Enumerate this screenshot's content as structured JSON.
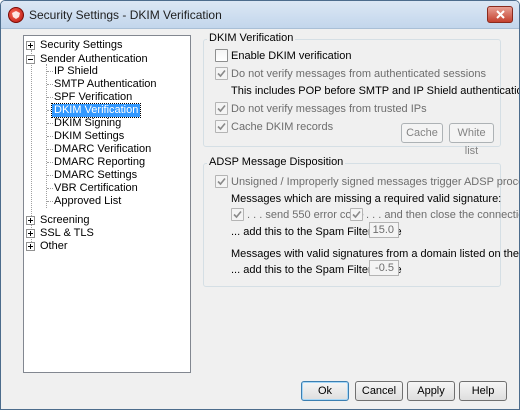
{
  "window": {
    "title": "Security Settings - DKIM Verification"
  },
  "tree": {
    "security_settings": "Security Settings",
    "sender_authentication": "Sender Authentication",
    "children": [
      "IP Shield",
      "SMTP Authentication",
      "SPF Verification",
      "DKIM Verification",
      "DKIM Signing",
      "DKIM Settings",
      "DMARC Verification",
      "DMARC Reporting",
      "DMARC Settings",
      "VBR Certification",
      "Approved List"
    ],
    "screening": "Screening",
    "ssl_tls": "SSL & TLS",
    "other": "Other"
  },
  "dkim": {
    "group_label": "DKIM Verification",
    "enable_label": "Enable DKIM verification",
    "enable_checked": false,
    "no_verify_auth_label": "Do not verify messages from authenticated sessions",
    "no_verify_auth_checked": true,
    "pop_note": "This includes POP before SMTP and IP Shield authentication.",
    "no_verify_trusted_label": "Do not verify messages from trusted IPs",
    "no_verify_trusted_checked": true,
    "cache_label": "Cache DKIM records",
    "cache_checked": true,
    "cache_button": "Cache",
    "whitelist_button": "White list"
  },
  "adsp": {
    "group_label": "ADSP Message Disposition",
    "unsigned_label": "Unsigned / Improperly signed messages trigger ADSP processing",
    "unsigned_checked": true,
    "missing_sig_heading": "Messages which are missing a required valid signature:",
    "send550_label": ". . . send 550 error code",
    "send550_checked": true,
    "close_conn_label": ". . . and then close the connection",
    "close_conn_checked": true,
    "spam_score_label_1": "... add this to the Spam Filter score",
    "spam_score_value_1": "15.0",
    "approved_heading": "Messages with valid signatures from a domain listed on the 'Approved List':",
    "spam_score_label_2": "... add this to the Spam Filter score",
    "spam_score_value_2": "-0.5"
  },
  "buttons": {
    "ok": "Ok",
    "cancel": "Cancel",
    "apply": "Apply",
    "help": "Help"
  }
}
